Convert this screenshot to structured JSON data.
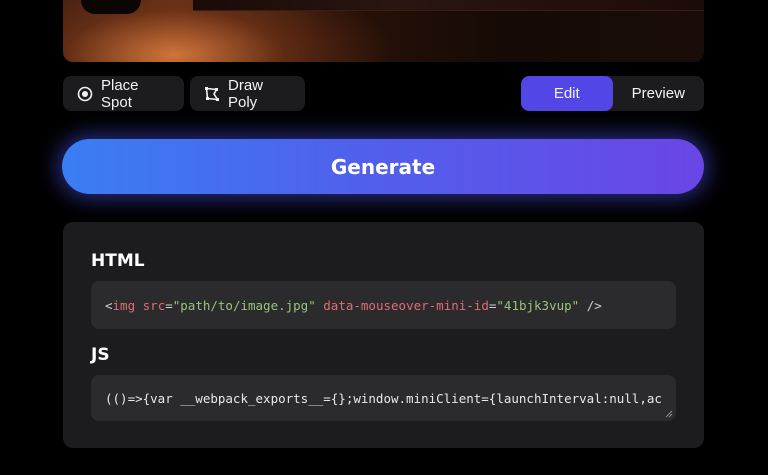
{
  "toolbar": {
    "place_spot_label": "Place Spot",
    "draw_poly_label": "Draw Poly",
    "edit_label": "Edit",
    "preview_label": "Preview",
    "active_mode": "Edit"
  },
  "generate": {
    "label": "Generate"
  },
  "output": {
    "html_title": "HTML",
    "html_code": {
      "open": "<",
      "tag": "img",
      "attr1": "src",
      "eq1": "=",
      "val1": "\"path/to/image.jpg\"",
      "attr2": "data-mouseover-mini-id",
      "eq2": "=",
      "val2": "\"41bjk3vup\"",
      "close": "/>"
    },
    "js_title": "JS",
    "js_code": "(()=>{var __webpack_exports__={};window.miniClient={launchInterval:null,ac"
  },
  "colors": {
    "accent": "#5247e6",
    "generate_start": "#3a7ef2",
    "generate_end": "#6a45e6",
    "panel_bg": "#1c1c1e",
    "code_bg": "#2b2b2d"
  },
  "icons": {
    "place_spot": "target-icon",
    "draw_poly": "polygon-icon",
    "resize": "resize-grip-icon"
  }
}
